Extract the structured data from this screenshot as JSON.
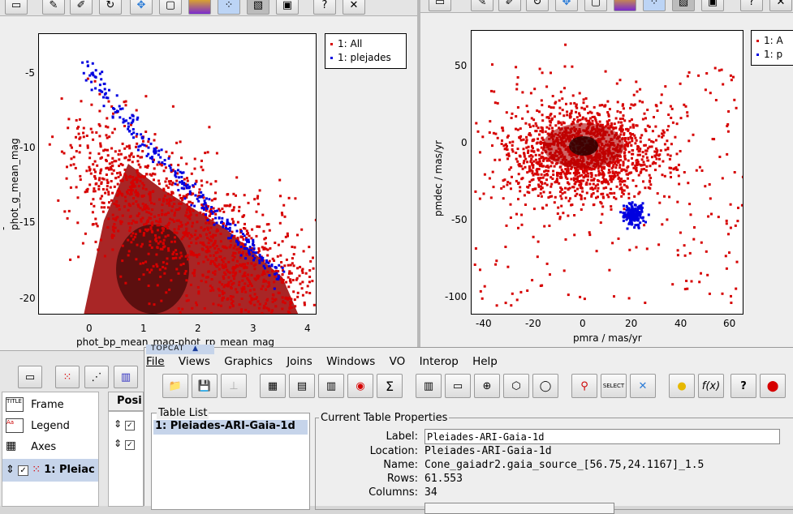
{
  "plot_left": {
    "xlabel": "phot_bp_mean_mag-phot_rp_mean_mag",
    "ylabel": "-phot_g_mean_mag",
    "xticks": [
      "0",
      "1",
      "2",
      "3",
      "4"
    ],
    "yticks": [
      "-5",
      "-10",
      "-15",
      "-20"
    ],
    "legend": [
      "1: All",
      "1: plejades"
    ]
  },
  "plot_right": {
    "xlabel": "pmra / mas/yr",
    "ylabel": "pmdec / mas/yr",
    "xticks": [
      "-40",
      "-20",
      "0",
      "20",
      "40",
      "60"
    ],
    "yticks": [
      "50",
      "0",
      "-50",
      "-100"
    ],
    "legend": [
      "1: A",
      "1: p"
    ]
  },
  "colors": {
    "all": "#d60000",
    "plejades": "#0000e0"
  },
  "control": {
    "tree": [
      "Frame",
      "Legend",
      "Axes",
      "1: Pleiac"
    ],
    "pos_tab": "Posi"
  },
  "topcat": {
    "title": "TOPCAT",
    "menu": [
      "File",
      "Views",
      "Graphics",
      "Joins",
      "Windows",
      "VO",
      "Interop",
      "Help"
    ],
    "table_list_title": "Table List",
    "table_item": "1: Pleiades-ARI-Gaia-1d",
    "props_title": "Current Table Properties",
    "props": [
      {
        "key": "Label:",
        "val": "Pleiades-ARI-Gaia-1d"
      },
      {
        "key": "Location:",
        "val": "Pleiades-ARI-Gaia-1d"
      },
      {
        "key": "Name:",
        "val": "Cone_gaiadr2.gaia_source_[56.75,24.1167]_1.5"
      },
      {
        "key": "Rows:",
        "val": "61.553"
      },
      {
        "key": "Columns:",
        "val": "34"
      }
    ]
  }
}
